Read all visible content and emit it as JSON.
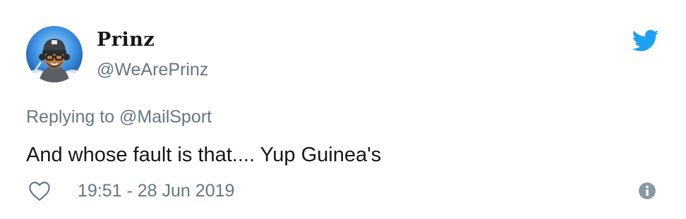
{
  "author": {
    "display_name": "Prinz",
    "username": "@WeArePrinz",
    "avatar_icon": "avatar-cartoon-gamer"
  },
  "reply": {
    "label": "Replying to",
    "handle": "@MailSport"
  },
  "tweet": {
    "text": "And whose fault is that.... Yup Guinea's",
    "timestamp": "19:51 - 28 Jun 2019"
  },
  "icons": {
    "like": "heart-outline-icon",
    "info": "info-circle-icon",
    "brand": "twitter-bird-icon"
  },
  "colors": {
    "twitter_blue": "#1DA1F2",
    "text_primary": "#14171A",
    "text_secondary": "#657786",
    "info_gray": "#8899A6"
  }
}
